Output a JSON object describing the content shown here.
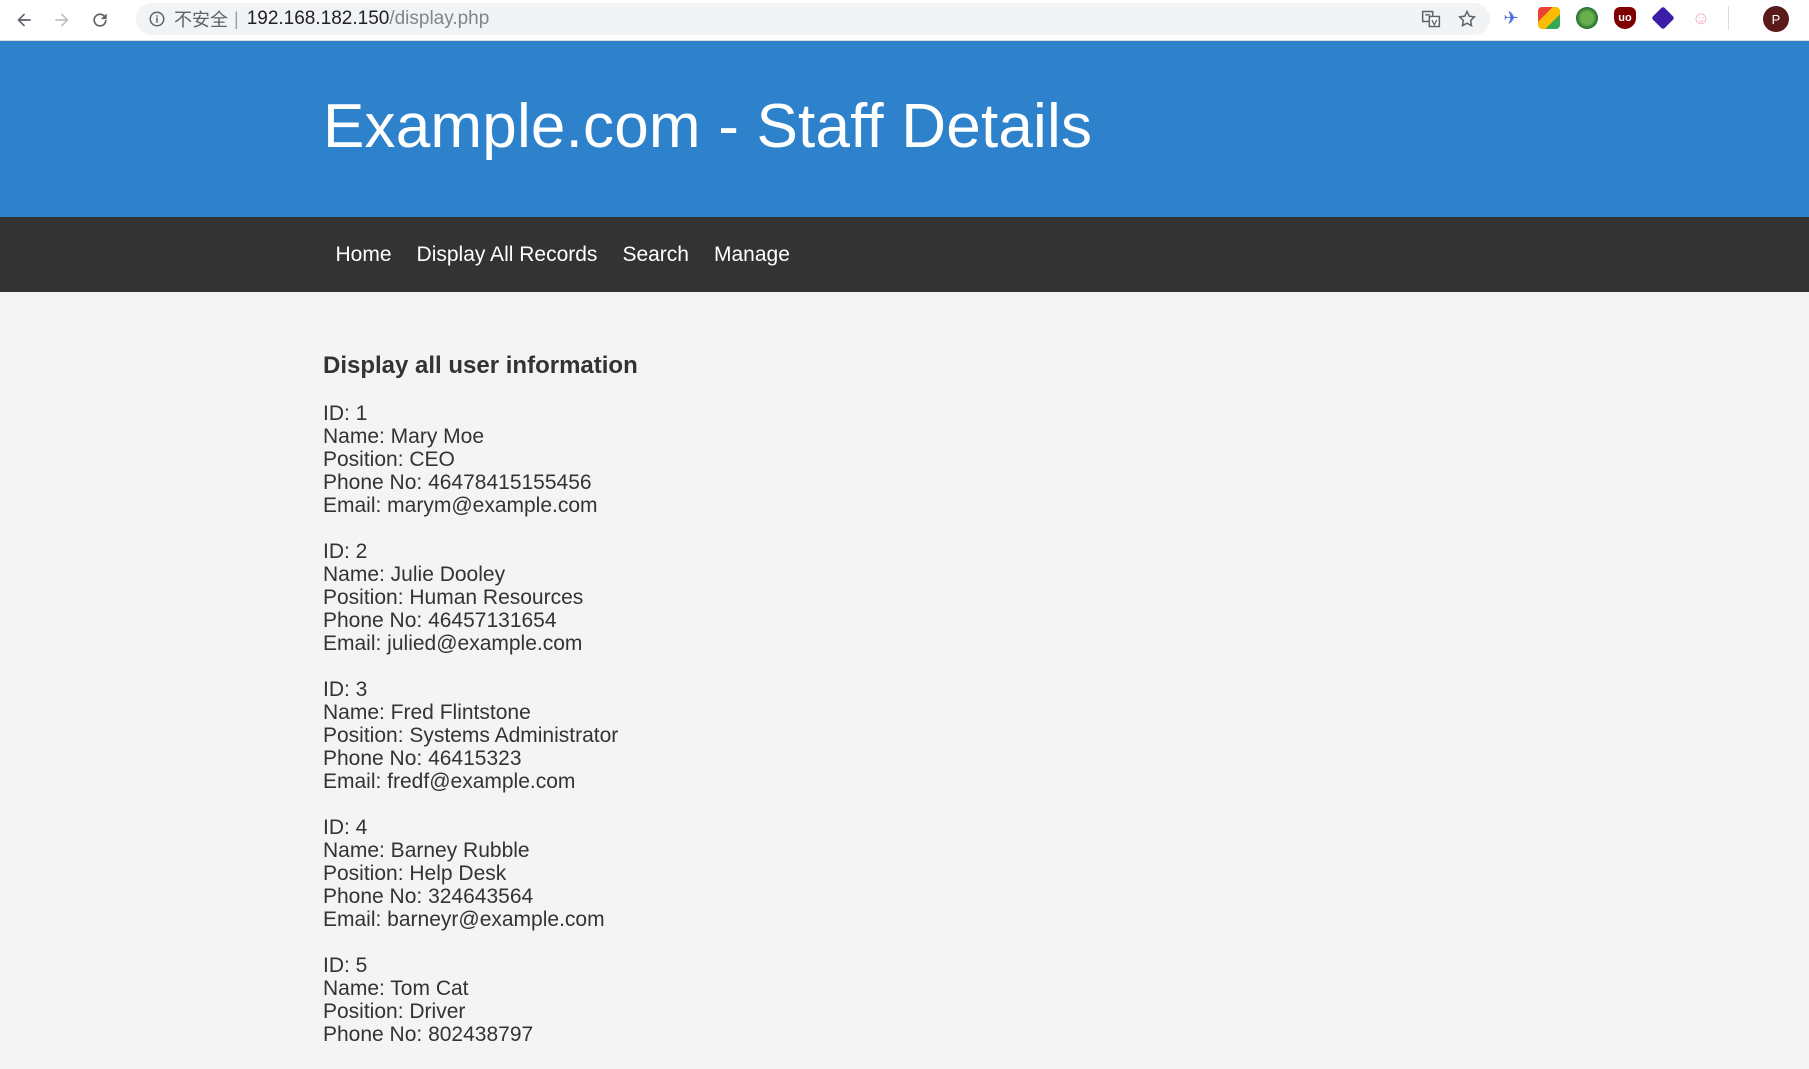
{
  "browser": {
    "security_label": "不安全",
    "separator": "|",
    "url_host": "192.168.182.150",
    "url_path": "/display.php",
    "avatar_initial": "P"
  },
  "header": {
    "title": "Example.com - Staff Details"
  },
  "nav": {
    "items": [
      {
        "label": "Home"
      },
      {
        "label": "Display All Records"
      },
      {
        "label": "Search"
      },
      {
        "label": "Manage"
      }
    ]
  },
  "main": {
    "heading": "Display all user information",
    "records": [
      {
        "id": "ID: 1",
        "name": "Name: Mary Moe",
        "position": "Position: CEO",
        "phone": "Phone No: 46478415155456",
        "email": "Email: marym@example.com"
      },
      {
        "id": "ID: 2",
        "name": "Name: Julie Dooley",
        "position": "Position: Human Resources",
        "phone": "Phone No: 46457131654",
        "email": "Email: julied@example.com"
      },
      {
        "id": "ID: 3",
        "name": "Name: Fred Flintstone",
        "position": "Position: Systems Administrator",
        "phone": "Phone No: 46415323",
        "email": "Email: fredf@example.com"
      },
      {
        "id": "ID: 4",
        "name": "Name: Barney Rubble",
        "position": "Position: Help Desk",
        "phone": "Phone No: 324643564",
        "email": "Email: barneyr@example.com"
      },
      {
        "id": "ID: 5",
        "name": "Name: Tom Cat",
        "position": "Position: Driver",
        "phone": "Phone No: 802438797",
        "email": ""
      }
    ]
  },
  "colors": {
    "header_bg": "#2e82cb",
    "nav_bg": "#333333",
    "page_bg": "#f4f4f4"
  }
}
